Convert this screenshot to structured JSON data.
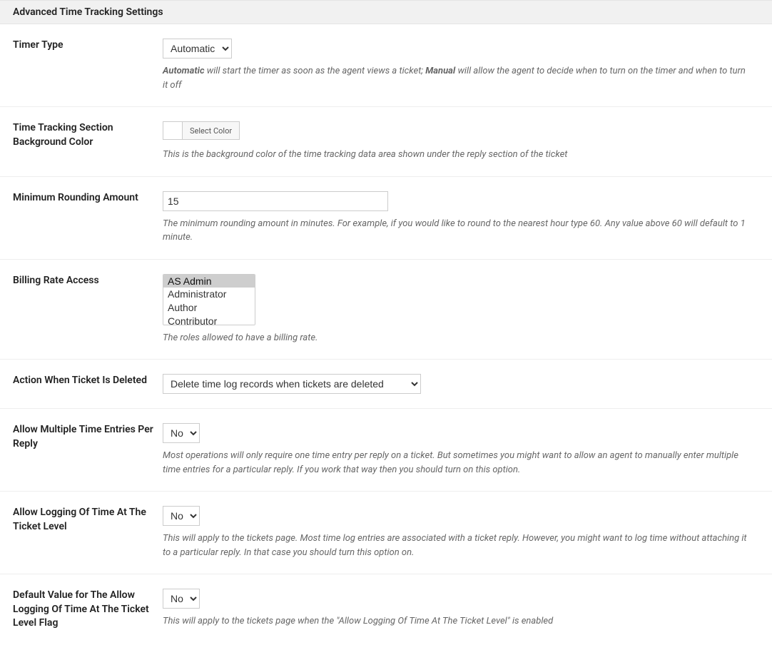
{
  "section_title": "Advanced Time Tracking Settings",
  "rows": {
    "timer_type": {
      "label": "Timer Type",
      "value": "Automatic",
      "desc_prefix": "Automatic",
      "desc_mid1": " will start the timer as soon as the agent views a ticket; ",
      "desc_bold2": "Manual",
      "desc_mid2": " will allow the agent to decide when to turn on the timer and when to turn it off"
    },
    "bg_color": {
      "label": "Time Tracking Section Background Color",
      "button_label": "Select Color",
      "desc": "This is the background color of the time tracking data area shown under the reply section of the ticket"
    },
    "min_round": {
      "label": "Minimum Rounding Amount",
      "value": "15",
      "desc": "The minimum rounding amount in minutes. For example, if you would like to round to the nearest hour type 60. Any value above 60 will default to 1 minute."
    },
    "billing_access": {
      "label": "Billing Rate Access",
      "options": [
        "AS Admin",
        "Administrator",
        "Author",
        "Contributor"
      ],
      "desc": "The roles allowed to have a billing rate."
    },
    "action_deleted": {
      "label": "Action When Ticket Is Deleted",
      "value": "Delete time log records when tickets are deleted"
    },
    "multi_entries": {
      "label": "Allow Multiple Time Entries Per Reply",
      "value": "No",
      "desc": "Most operations will only require one time entry per reply on a ticket. But sometimes you might want to allow an agent to manually enter multiple time entries for a particular reply. If you work that way then you should turn on this option."
    },
    "log_ticket_level": {
      "label": "Allow Logging Of Time At The Ticket Level",
      "value": "No",
      "desc": "This will apply to the tickets page. Most time log entries are associated with a ticket reply. However, you might want to log time without attaching it to a particular reply. In that case you should turn this option on."
    },
    "default_log_ticket": {
      "label": "Default Value for The Allow Logging Of Time At The Ticket Level Flag",
      "value": "No",
      "desc": "This will apply to the tickets page when the \"Allow Logging Of Time At The Ticket Level\" is enabled"
    }
  }
}
